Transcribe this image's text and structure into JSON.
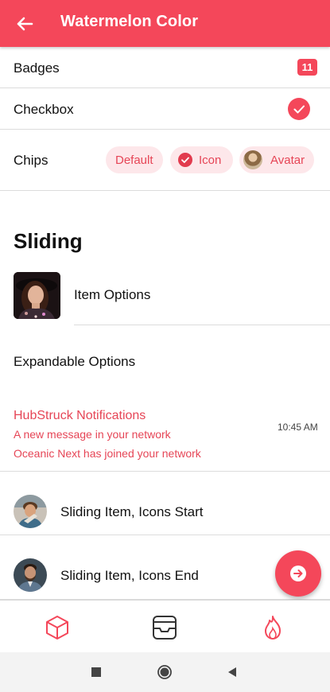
{
  "header": {
    "title": "Watermelon Color",
    "back_icon": "arrow-left-icon"
  },
  "rows": {
    "badges": {
      "label": "Badges",
      "badge_count": "11"
    },
    "checkbox": {
      "label": "Checkbox",
      "checked": true
    },
    "chips": {
      "label": "Chips",
      "items": [
        {
          "label": "Default"
        },
        {
          "label": "Icon"
        },
        {
          "label": "Avatar"
        }
      ]
    }
  },
  "sliding": {
    "heading": "Sliding",
    "item_options": "Item Options",
    "expandable_options": "Expandable Options",
    "notification": {
      "title": "HubStruck Notifications",
      "lines": [
        "A new message in your network",
        "Oceanic Next has joined your network"
      ],
      "time": "10:45 AM"
    },
    "icons_start": "Sliding Item, Icons Start",
    "icons_end": "Sliding Item, Icons End"
  },
  "fab": {
    "icon": "arrow-forward-circle-icon"
  },
  "tabs": [
    {
      "icon": "cube-icon"
    },
    {
      "icon": "archive-icon"
    },
    {
      "icon": "flame-icon"
    }
  ],
  "system_nav": {
    "icons": [
      "recents-square-icon",
      "home-circle-icon",
      "back-triangle-icon"
    ]
  },
  "colors": {
    "accent": "#f4475a",
    "chip_bg": "#fde7ea",
    "accent_text": "#e64556"
  }
}
